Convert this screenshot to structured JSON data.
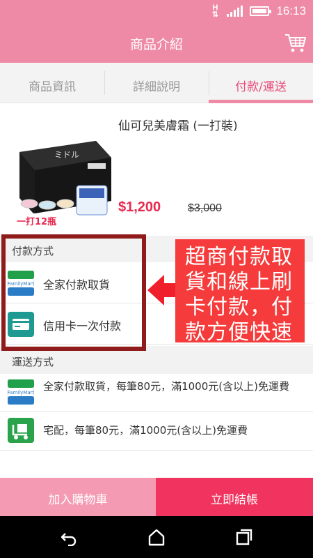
{
  "status_bar": {
    "network_type": "H",
    "time": "16:13"
  },
  "app_bar": {
    "title": "商品介紹",
    "cart_icon": "shopping-cart-icon"
  },
  "tabs": [
    {
      "label": "商品資訊",
      "active": false
    },
    {
      "label": "詳細說明",
      "active": false
    },
    {
      "label": "付款/運送",
      "active": true
    }
  ],
  "product": {
    "title": "仙可兒美膚霜 (一打裝)",
    "image_caption": "一打12瓶",
    "price": "$1,200",
    "original_price": "$3,000"
  },
  "payment": {
    "header": "付款方式",
    "options": [
      {
        "label": "全家付款取貨",
        "icon": "familymart-icon"
      },
      {
        "label": "信用卡一次付款",
        "icon": "credit-card-icon"
      }
    ]
  },
  "shipping": {
    "header": "運送方式",
    "options": [
      {
        "label": "全家付款取貨，每筆80元，滿1000元(含以上)免運費",
        "icon": "familymart-icon"
      },
      {
        "label": "宅配，每筆80元，滿1000元(含以上)免運費",
        "icon": "home-delivery-icon"
      }
    ]
  },
  "callout": {
    "text": "超商付款取貨和線上刷卡付款，付款方便快速"
  },
  "bottom_actions": {
    "add_to_cart": "加入購物車",
    "checkout": "立即結帳"
  },
  "colors": {
    "brand_pink": "#ee8aa6",
    "checkout_red": "#f0345f",
    "price_red": "#e8294f",
    "callout_red": "#f53b3b",
    "frame_dark_red": "#8f1b1b"
  }
}
